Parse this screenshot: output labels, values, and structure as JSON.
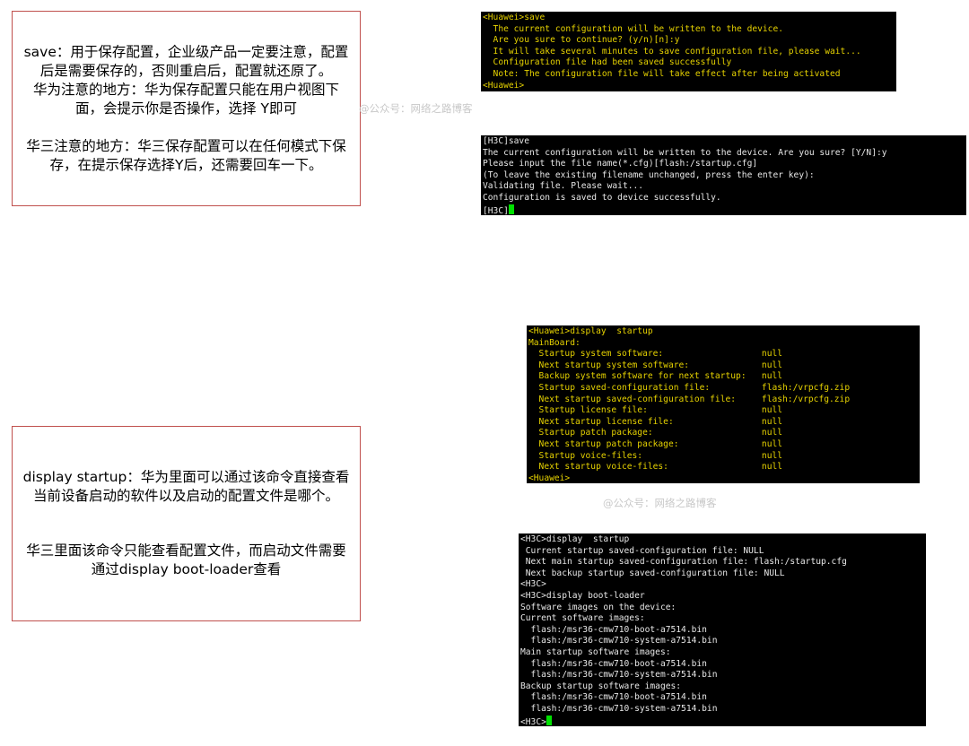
{
  "notes": {
    "save": {
      "line1": "save：用于保存配置，企业级产品一定要注意，配置后是需要保存的，否则重启后，配置就还原了。",
      "line2": "华为注意的地方：华为保存配置只能在用户视图下面，会提示你是否操作，选择 Y即可",
      "line3": "华三注意的地方：华三保存配置可以在任何模式下保存，在提示保存选择Y后，还需要回车一下。"
    },
    "startup": {
      "line1": "display startup：华为里面可以通过该命令直接查看当前设备启动的软件以及启动的配置文件是哪个。",
      "line2": "华三里面该命令只能查看配置文件，而启动文件需要通过display boot-loader查看"
    }
  },
  "watermark": "@公众号：网络之路博客",
  "terminals": {
    "huawei_save": [
      "<Huawei>save",
      "  The current configuration will be written to the device.",
      "  Are you sure to continue? (y/n)[n]:y",
      "  It will take several minutes to save configuration file, please wait...",
      "  Configuration file had been saved successfully",
      "  Note: The configuration file will take effect after being activated",
      "<Huawei>"
    ],
    "h3c_save": [
      "[H3C]save",
      "The current configuration will be written to the device. Are you sure? [Y/N]:y",
      "Please input the file name(*.cfg)[flash:/startup.cfg]",
      "(To leave the existing filename unchanged, press the enter key):",
      "Validating file. Please wait...",
      "Configuration is saved to device successfully.",
      "[H3C]"
    ],
    "huawei_startup": [
      "<Huawei>display  startup",
      "MainBoard:",
      "  Startup system software:                   null",
      "  Next startup system software:              null",
      "  Backup system software for next startup:   null",
      "  Startup saved-configuration file:          flash:/vrpcfg.zip",
      "  Next startup saved-configuration file:     flash:/vrpcfg.zip",
      "  Startup license file:                      null",
      "  Next startup license file:                 null",
      "  Startup patch package:                     null",
      "  Next startup patch package:                null",
      "  Startup voice-files:                       null",
      "  Next startup voice-files:                  null",
      "<Huawei>"
    ],
    "h3c_startup": [
      "<H3C>display  startup",
      " Current startup saved-configuration file: NULL",
      " Next main startup saved-configuration file: flash:/startup.cfg",
      " Next backup startup saved-configuration file: NULL",
      "<H3C>",
      "<H3C>display boot-loader",
      "Software images on the device:",
      "Current software images:",
      "  flash:/msr36-cmw710-boot-a7514.bin",
      "  flash:/msr36-cmw710-system-a7514.bin",
      "Main startup software images:",
      "  flash:/msr36-cmw710-boot-a7514.bin",
      "  flash:/msr36-cmw710-system-a7514.bin",
      "Backup startup software images:",
      "  flash:/msr36-cmw710-boot-a7514.bin",
      "  flash:/msr36-cmw710-system-a7514.bin",
      "<H3C>"
    ]
  },
  "colors": {
    "box_border": "#c0504d",
    "huawei_text": "#e6d200",
    "h3c_text": "#e8e8e8",
    "cursor": "#00e000"
  }
}
